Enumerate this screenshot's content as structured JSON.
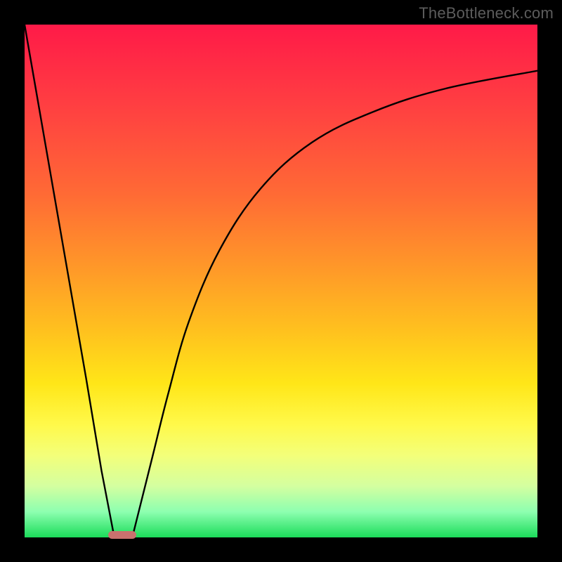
{
  "watermark": "TheBottleneck.com",
  "colors": {
    "frame": "#000000",
    "gradient_top": "#ff1a48",
    "gradient_bottom": "#1bdc5a",
    "curve": "#000000",
    "marker": "#c9716e"
  },
  "chart_data": {
    "type": "line",
    "title": "",
    "xlabel": "",
    "ylabel": "",
    "x_range": [
      0,
      100
    ],
    "y_range": [
      0,
      100
    ],
    "series": [
      {
        "name": "left-descent",
        "x": [
          0,
          4,
          8,
          12,
          15,
          17.5
        ],
        "y": [
          100,
          77,
          54,
          31,
          13,
          0
        ]
      },
      {
        "name": "right-ascent",
        "x": [
          21,
          23,
          25,
          28,
          32,
          38,
          46,
          56,
          68,
          82,
          100
        ],
        "y": [
          0,
          8,
          16,
          28,
          42,
          56,
          68,
          77,
          83,
          87.5,
          91
        ]
      }
    ],
    "annotations": [
      {
        "name": "min-marker",
        "shape": "rounded-bar",
        "x_center": 19,
        "y": 0.5,
        "width_pct": 5.5
      }
    ],
    "ticks": {
      "x": [],
      "y": []
    },
    "grid": false,
    "legend": false
  }
}
